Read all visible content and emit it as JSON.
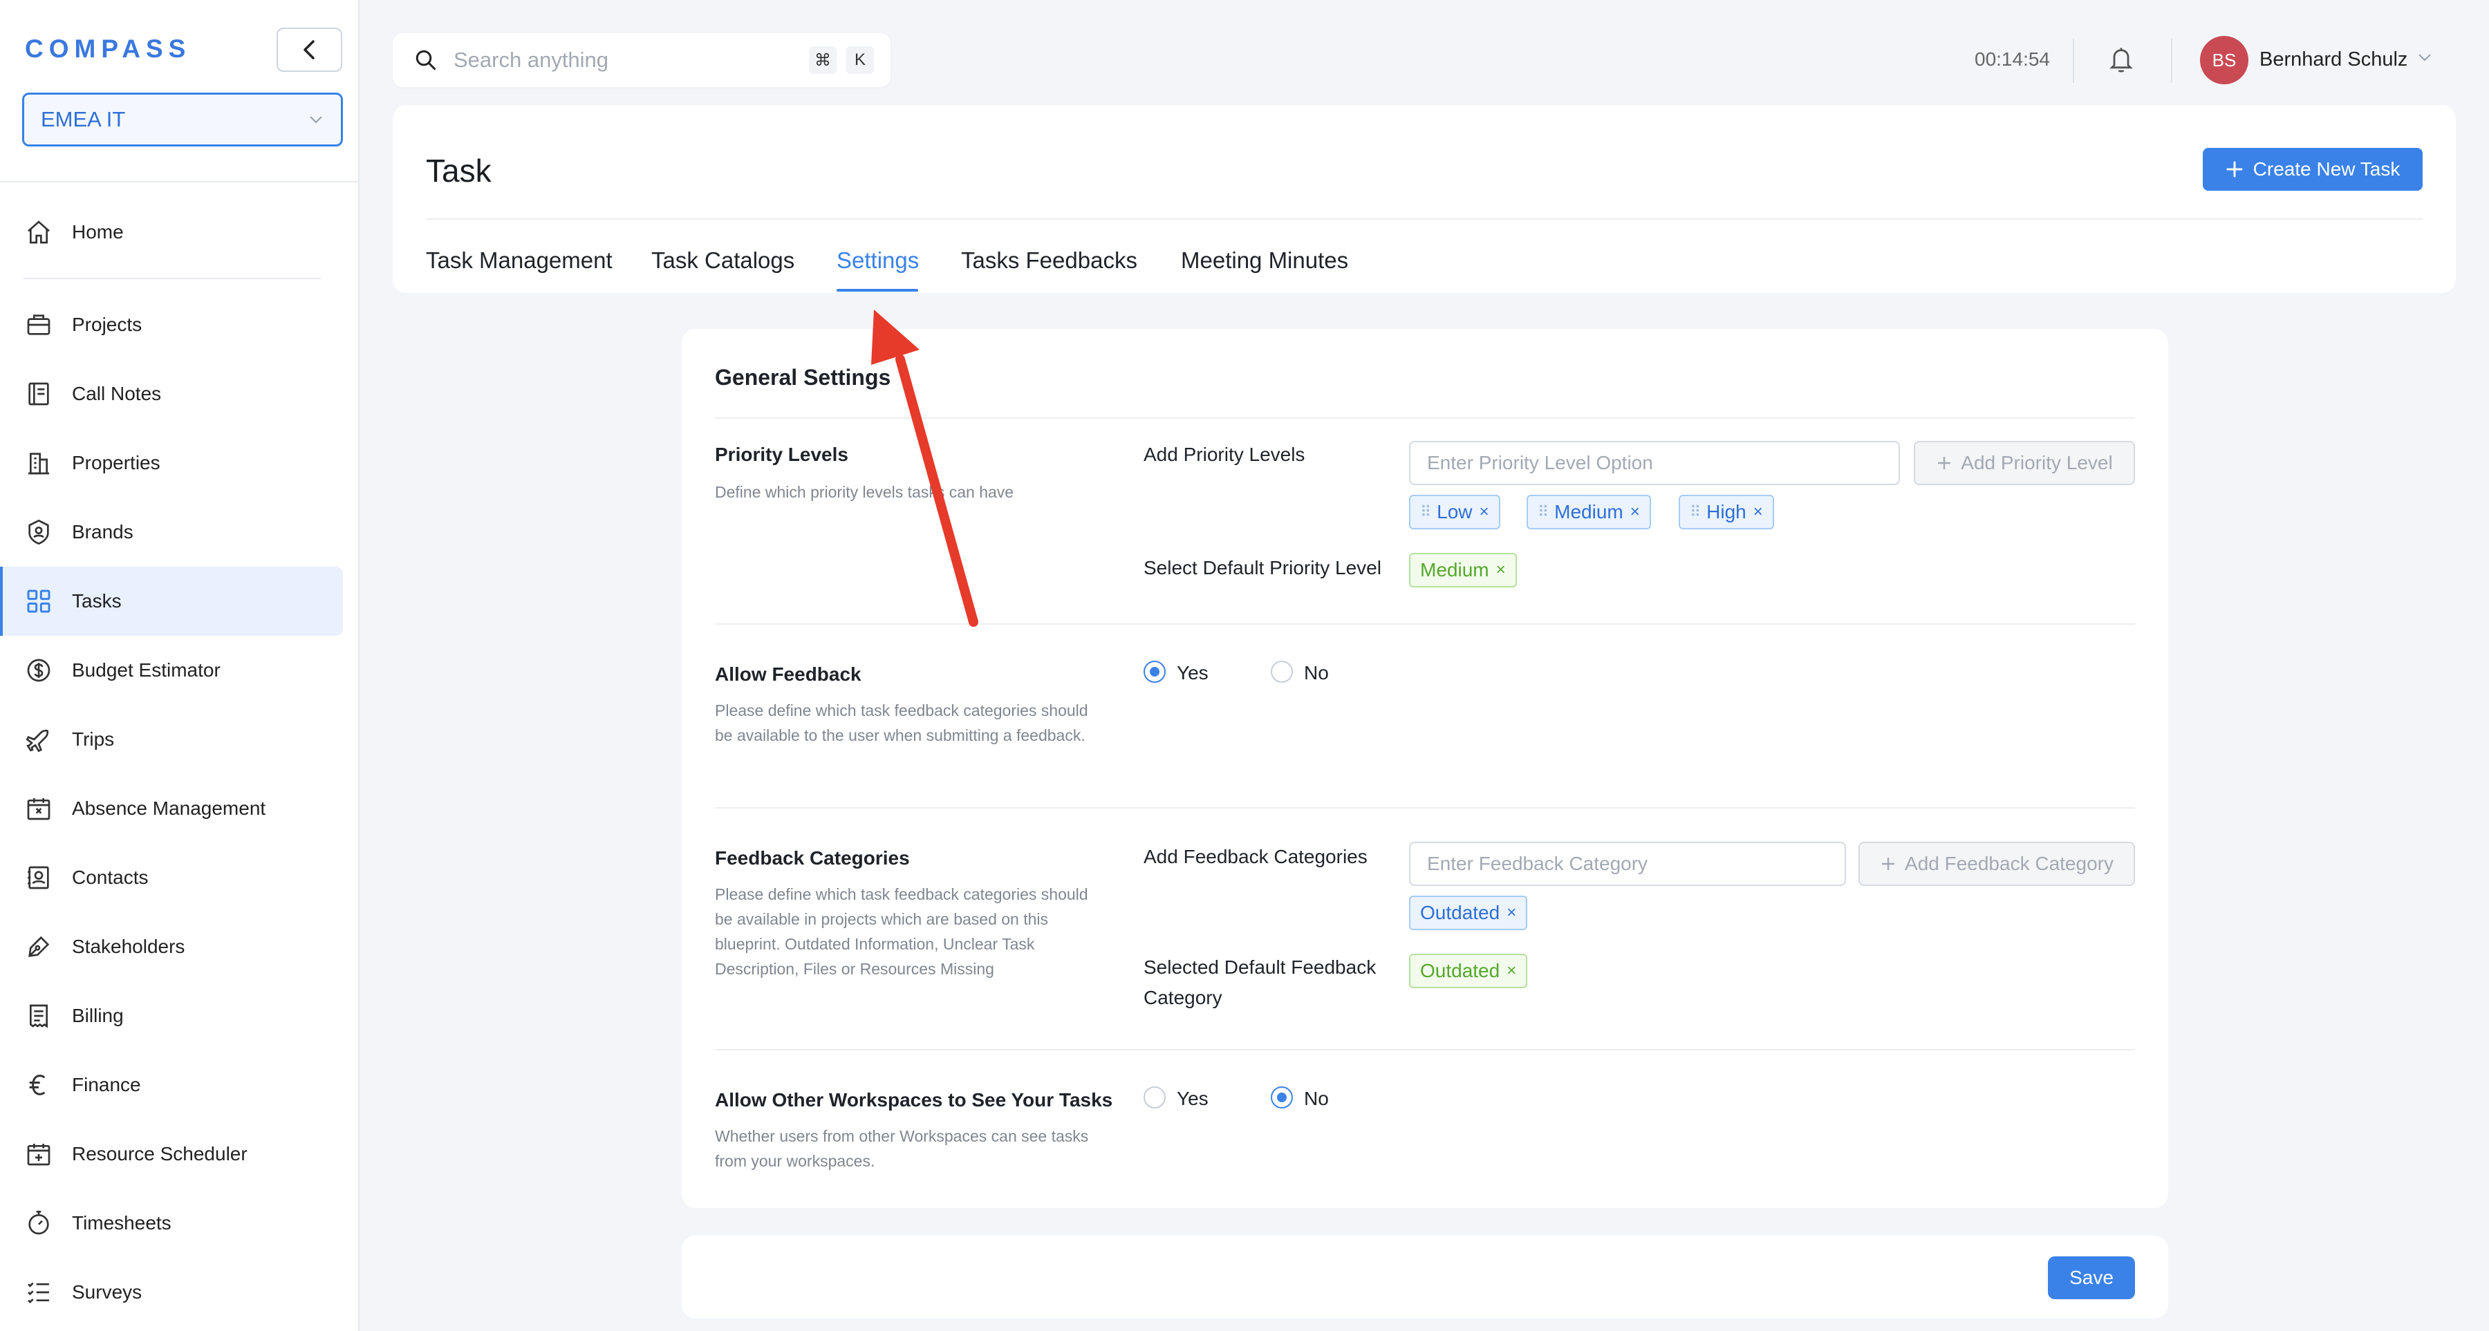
{
  "app": {
    "logo": "COMPASS"
  },
  "sidebar": {
    "workspace": "EMEA IT",
    "items": [
      {
        "label": "Home",
        "icon": "home-icon"
      },
      {
        "label": "Projects",
        "icon": "briefcase-icon"
      },
      {
        "label": "Call Notes",
        "icon": "notebook-icon"
      },
      {
        "label": "Properties",
        "icon": "building-icon"
      },
      {
        "label": "Brands",
        "icon": "badge-icon"
      },
      {
        "label": "Tasks",
        "icon": "grid-icon",
        "active": true
      },
      {
        "label": "Budget Estimator",
        "icon": "dollar-icon"
      },
      {
        "label": "Trips",
        "icon": "plane-icon"
      },
      {
        "label": "Absence Management",
        "icon": "calendar-x-icon"
      },
      {
        "label": "Contacts",
        "icon": "contact-icon"
      },
      {
        "label": "Stakeholders",
        "icon": "pen-icon"
      },
      {
        "label": "Billing",
        "icon": "receipt-icon"
      },
      {
        "label": "Finance",
        "icon": "euro-icon"
      },
      {
        "label": "Resource Scheduler",
        "icon": "calendar-plus-icon"
      },
      {
        "label": "Timesheets",
        "icon": "stopwatch-icon"
      },
      {
        "label": "Surveys",
        "icon": "list-check-icon"
      }
    ]
  },
  "topbar": {
    "search_placeholder": "Search anything",
    "shortcut_cmd": "⌘",
    "shortcut_key": "K",
    "timer": "00:14:54",
    "user_initials": "BS",
    "user_name": "Bernhard Schulz",
    "avatar_color": "#c94a52"
  },
  "header": {
    "title": "Task",
    "create_label": "Create New Task",
    "tabs": [
      {
        "label": "Task Management"
      },
      {
        "label": "Task Catalogs"
      },
      {
        "label": "Settings",
        "active": true
      },
      {
        "label": "Tasks Feedbacks"
      },
      {
        "label": "Meeting Minutes"
      }
    ]
  },
  "settings": {
    "title": "General Settings",
    "priority": {
      "title": "Priority Levels",
      "desc": "Define which priority levels tasks can have",
      "add_label": "Add Priority Levels",
      "input_placeholder": "Enter Priority Level Option",
      "add_button": "Add Priority Level",
      "levels": [
        "Low",
        "Medium",
        "High"
      ],
      "default_label": "Select Default Priority Level",
      "default_value": "Medium"
    },
    "feedback": {
      "title": "Allow Feedback",
      "desc": "Please define which task feedback categories should be available to the user when submitting a feedback.",
      "yes": "Yes",
      "no": "No",
      "selected": "Yes"
    },
    "categories": {
      "title": "Feedback Categories",
      "desc": "Please define which task feedback categories should be available in projects which are based on this blueprint. Outdated Information, Unclear Task Description, Files or Resources Missing",
      "add_label": "Add Feedback Categories",
      "input_placeholder": "Enter Feedback Category",
      "add_button": "Add Feedback Category",
      "items": [
        "Outdated"
      ],
      "default_label": "Selected Default Feedback Category",
      "default_value": "Outdated"
    },
    "workspaces": {
      "title": "Allow Other Workspaces to See Your Tasks",
      "desc": "Whether users from other Workspaces can see tasks from your workspaces.",
      "yes": "Yes",
      "no": "No",
      "selected": "No"
    }
  },
  "footer": {
    "save_label": "Save"
  },
  "colors": {
    "accent": "#3a82e8",
    "annotation_arrow": "#e63a2b",
    "tag_green": "#55a82d"
  }
}
